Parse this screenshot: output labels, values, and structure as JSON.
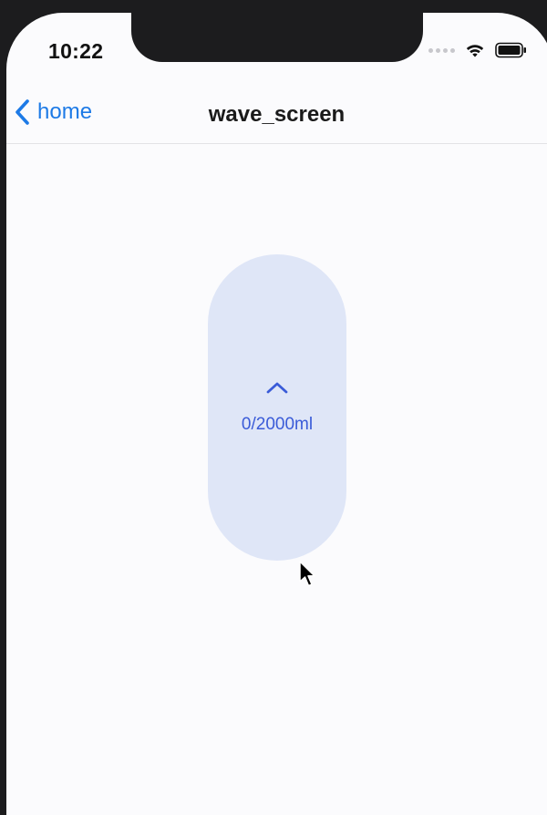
{
  "status_bar": {
    "time": "10:22",
    "icons": [
      "cellular-dots-icon",
      "wifi-icon",
      "battery-icon"
    ]
  },
  "nav": {
    "back_label": "home",
    "title": "wave_screen",
    "accent_color": "#1d7ae6"
  },
  "water_widget": {
    "arrow_icon": "chevron-up-icon",
    "amount_label": "0/2000ml",
    "current_ml": 0,
    "goal_ml": 2000,
    "fill_color": "#dfe6f7",
    "text_color": "#3a5bd8"
  }
}
